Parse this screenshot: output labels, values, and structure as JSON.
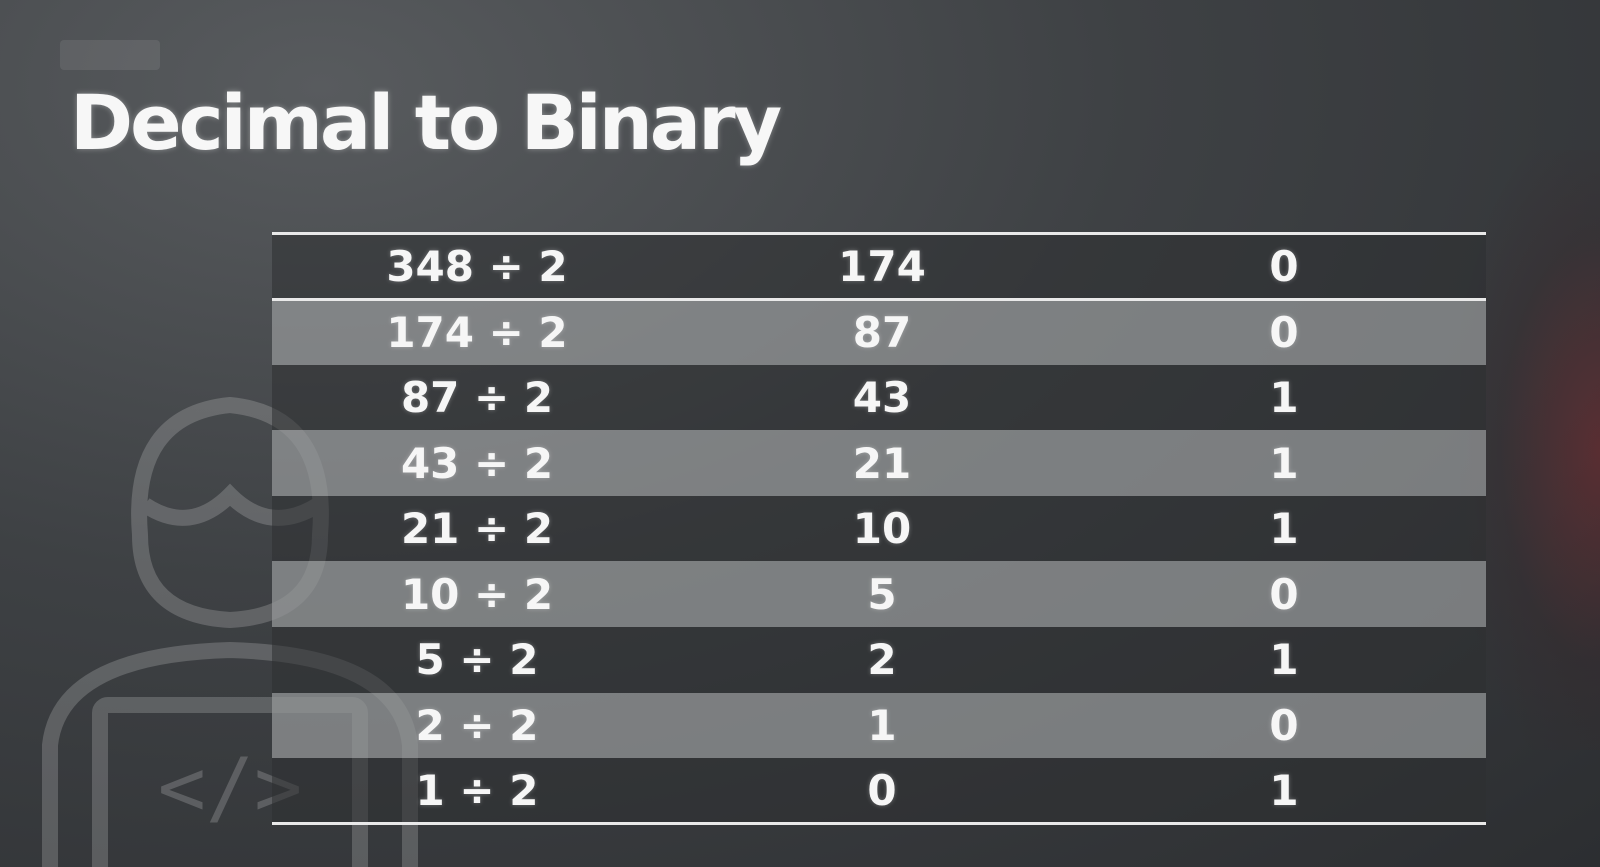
{
  "slide": {
    "title": "Decimal to Binary"
  },
  "illustration": {
    "icon": "developer-code-icon",
    "glyph": "</>"
  },
  "table": {
    "rows": [
      {
        "expression": "348 ÷ 2",
        "quotient": "174",
        "remainder": "0"
      },
      {
        "expression": "174 ÷ 2",
        "quotient": "87",
        "remainder": "0"
      },
      {
        "expression": "87 ÷ 2",
        "quotient": "43",
        "remainder": "1"
      },
      {
        "expression": "43 ÷ 2",
        "quotient": "21",
        "remainder": "1"
      },
      {
        "expression": "21 ÷ 2",
        "quotient": "10",
        "remainder": "1"
      },
      {
        "expression": "10 ÷ 2",
        "quotient": "5",
        "remainder": "0"
      },
      {
        "expression": "5 ÷ 2",
        "quotient": "2",
        "remainder": "1"
      },
      {
        "expression": "2 ÷ 2",
        "quotient": "1",
        "remainder": "0"
      },
      {
        "expression": "1 ÷ 2",
        "quotient": "0",
        "remainder": "1"
      }
    ]
  },
  "colors": {
    "text": "#f6f6f6",
    "row_dark": "#2d2f32",
    "row_light": "#96989a",
    "rule": "#e9e9e9"
  }
}
